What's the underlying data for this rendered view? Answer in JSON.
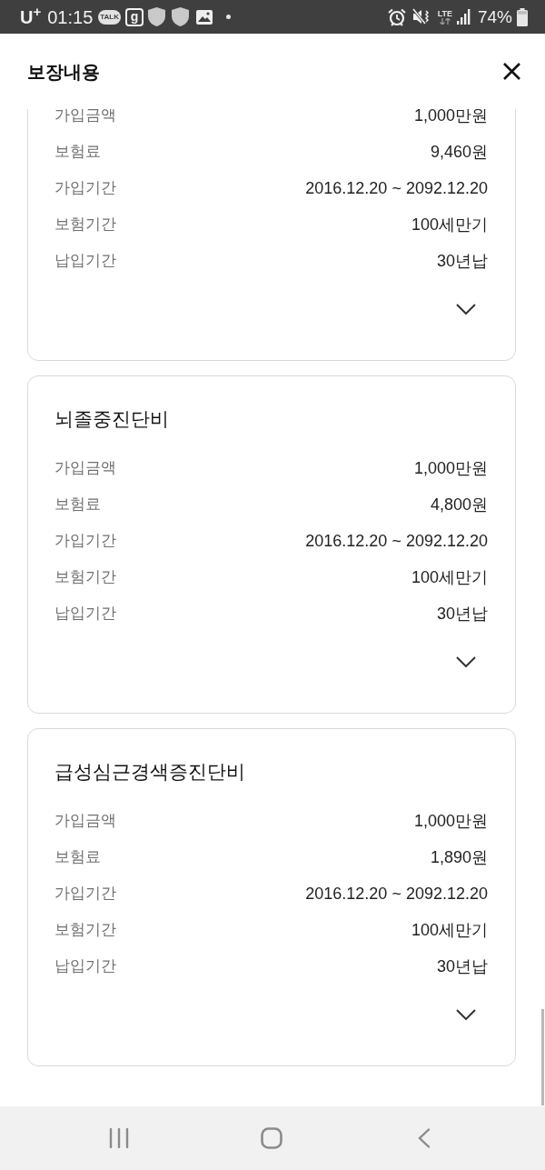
{
  "status_bar": {
    "carrier": "U$^{+}$",
    "time": "01:15",
    "talk_label": "TALK",
    "app_letter": "g",
    "network": "LTE",
    "battery": "74%"
  },
  "header": {
    "title": "보장내용"
  },
  "cards": [
    {
      "rows": [
        {
          "label": "가입금액",
          "value": "1,000만원"
        },
        {
          "label": "보험료",
          "value": "9,460원"
        },
        {
          "label": "가입기간",
          "value": "2016.12.20 ~ 2092.12.20"
        },
        {
          "label": "보험기간",
          "value": "100세만기"
        },
        {
          "label": "납입기간",
          "value": "30년납"
        }
      ]
    },
    {
      "title": "뇌졸중진단비",
      "rows": [
        {
          "label": "가입금액",
          "value": "1,000만원"
        },
        {
          "label": "보험료",
          "value": "4,800원"
        },
        {
          "label": "가입기간",
          "value": "2016.12.20 ~ 2092.12.20"
        },
        {
          "label": "보험기간",
          "value": "100세만기"
        },
        {
          "label": "납입기간",
          "value": "30년납"
        }
      ]
    },
    {
      "title": "급성심근경색증진단비",
      "rows": [
        {
          "label": "가입금액",
          "value": "1,000만원"
        },
        {
          "label": "보험료",
          "value": "1,890원"
        },
        {
          "label": "가입기간",
          "value": "2016.12.20 ~ 2092.12.20"
        },
        {
          "label": "보험기간",
          "value": "100세만기"
        },
        {
          "label": "납입기간",
          "value": "30년납"
        }
      ]
    }
  ]
}
